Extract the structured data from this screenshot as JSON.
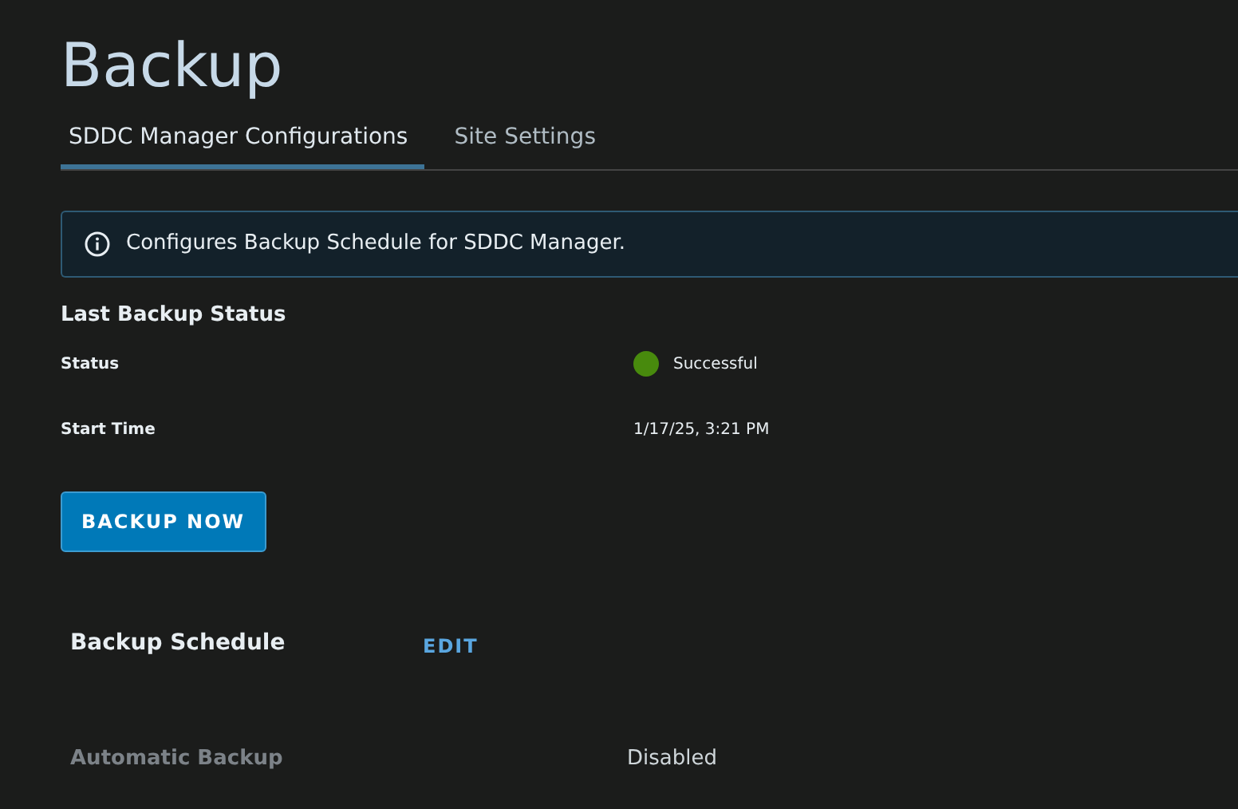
{
  "title": "Backup",
  "tabs": [
    {
      "label": "SDDC Manager Configurations",
      "selected": true
    },
    {
      "label": "Site Settings",
      "selected": false
    }
  ],
  "alert": {
    "text": "Configures Backup Schedule for SDDC Manager."
  },
  "last_backup": {
    "heading": "Last Backup Status",
    "rows": [
      {
        "label": "Status",
        "value": "Successful",
        "color": "#488a0d"
      },
      {
        "label": "Start Time",
        "value": "1/17/25, 3:21 PM"
      }
    ]
  },
  "backup_button": "BACKUP NOW",
  "schedule": {
    "heading": "Backup Schedule",
    "edit": "EDIT",
    "rows": [
      {
        "label": "Automatic Backup",
        "value": "Disabled"
      }
    ]
  }
}
